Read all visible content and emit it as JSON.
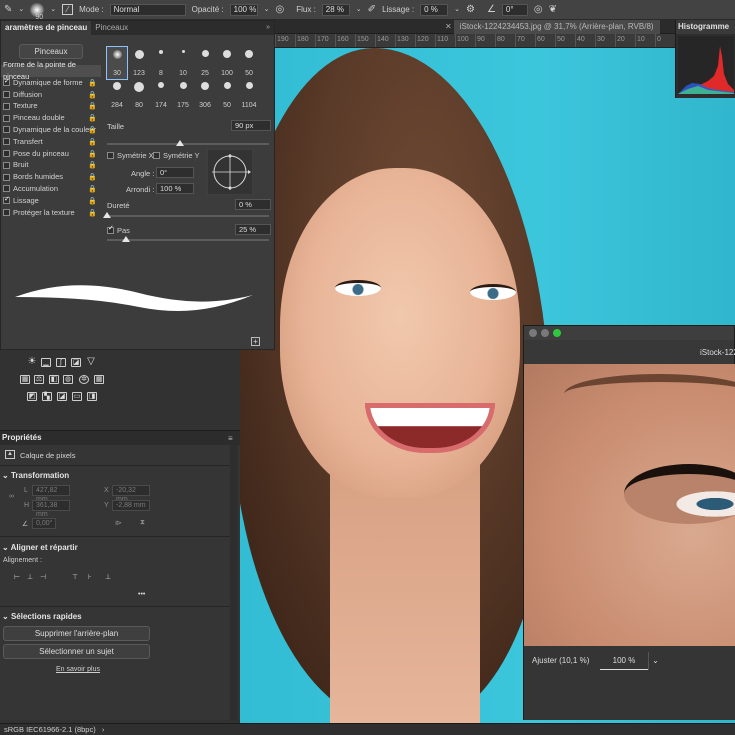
{
  "options_bar": {
    "brush_size": "90",
    "mode_label": "Mode :",
    "mode_value": "Normal",
    "opacity_label": "Opacité :",
    "opacity_value": "100 %",
    "flow_label": "Flux :",
    "flow_value": "28 %",
    "smoothing_label": "Lissage :",
    "smoothing_value": "0 %",
    "angle_value": "0°"
  },
  "document_tab": {
    "title": "iStock-1224234453.jpg @ 31,7% (Arrière-plan, RVB/8)"
  },
  "ruler": [
    "190",
    "180",
    "170",
    "160",
    "150",
    "140",
    "130",
    "120",
    "110",
    "100",
    "90",
    "80",
    "70",
    "60",
    "50",
    "40",
    "30",
    "20",
    "10",
    "0"
  ],
  "histogram": {
    "title": "Histogramme"
  },
  "brush_panel": {
    "tab_active": "aramètres de pinceau",
    "tab_other": "Pinceaux",
    "brushes_button": "Pinceaux",
    "options": [
      {
        "label": "Forme de la pointe de pinceau",
        "head": true,
        "checked": false,
        "lock": false
      },
      {
        "label": "Dynamique de forme",
        "checked": true,
        "lock": true
      },
      {
        "label": "Diffusion",
        "checked": false,
        "lock": true
      },
      {
        "label": "Texture",
        "checked": false,
        "lock": true
      },
      {
        "label": "Pinceau double",
        "checked": false,
        "lock": true
      },
      {
        "label": "Dynamique de la couleur",
        "checked": false,
        "lock": true
      },
      {
        "label": "Transfert",
        "checked": false,
        "lock": true
      },
      {
        "label": "Pose du pinceau",
        "checked": false,
        "lock": true
      },
      {
        "label": "Bruit",
        "checked": false,
        "lock": true
      },
      {
        "label": "Bords humides",
        "checked": false,
        "lock": true
      },
      {
        "label": "Accumulation",
        "checked": false,
        "lock": true
      },
      {
        "label": "Lissage",
        "checked": true,
        "lock": true
      },
      {
        "label": "Protéger la texture",
        "checked": false,
        "lock": true
      }
    ],
    "tips": [
      "30",
      "123",
      "8",
      "10",
      "25",
      "100",
      "50",
      "284",
      "80",
      "174",
      "175",
      "306",
      "50",
      "1104"
    ],
    "size_label": "Taille",
    "size_value": "90 px",
    "flip_x": "Symétrie X",
    "flip_y": "Symétrie Y",
    "angle_label": "Angle :",
    "angle_value": "0°",
    "roundness_label": "Arrondi :",
    "roundness_value": "100 %",
    "hardness_label": "Dureté",
    "hardness_value": "0 %",
    "spacing_label": "Pas",
    "spacing_value": "25 %",
    "size_level": 0.45,
    "hardness_level": 0.0,
    "spacing_level": 0.12
  },
  "properties": {
    "title": "Propriétés",
    "layer_type": "Calque de pixels",
    "transform_title": "Transformation",
    "w_label": "L",
    "w_value": "427,82 mm",
    "h_label": "H",
    "h_value": "361,38 mm",
    "x_label": "X",
    "x_value": "-20,32 mm",
    "y_label": "Y",
    "y_value": "-2,88 mm",
    "angle_value": "0,00°",
    "align_title": "Aligner et répartir",
    "align_label": "Alignement :",
    "more": "•••",
    "quick_title": "Sélections rapides",
    "remove_bg": "Supprimer l'arrière-plan",
    "select_subject": "Sélectionner un sujet",
    "learn_more": "En savoir plus"
  },
  "status_bar": {
    "profile": "sRGB IEC61966-2.1 (8bpc)"
  },
  "navigator_window": {
    "title": "iStock-122",
    "fit_label": "Ajuster (10,1 %)",
    "zoom_value": "100 %"
  }
}
